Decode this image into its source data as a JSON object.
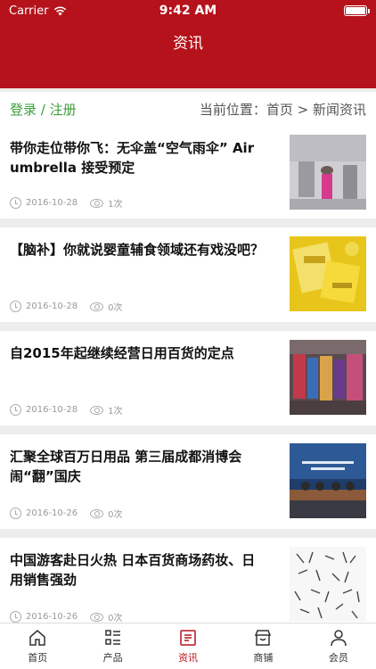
{
  "status": {
    "carrier": "Carrier",
    "time": "9:42 AM"
  },
  "nav": {
    "title": "资讯"
  },
  "crumb": {
    "login": "登录 / 注册",
    "position": "当前位置：首页 > 新闻资讯"
  },
  "articles": [
    {
      "title": "带你走位带你飞：无伞盖“空气雨伞” Air umbrella 接受预定",
      "date": "2016-10-28",
      "views": "1次"
    },
    {
      "title": "【脑补】你就说婴童辅食领域还有戏没吧？",
      "date": "2016-10-28",
      "views": "0次"
    },
    {
      "title": "自2015年起继续经营日用百货的定点",
      "date": "2016-10-28",
      "views": "1次"
    },
    {
      "title": "汇聚全球百万日用品 第三届成都消博会闹“翻”国庆",
      "date": "2016-10-26",
      "views": "0次"
    },
    {
      "title": "中国游客赴日火热 日本百货商场药妆、日用销售强劲",
      "date": "2016-10-26",
      "views": "0次"
    }
  ],
  "tabs": [
    {
      "label": "首页",
      "icon": "home-icon"
    },
    {
      "label": "产品",
      "icon": "list-icon"
    },
    {
      "label": "资讯",
      "icon": "news-icon"
    },
    {
      "label": "商铺",
      "icon": "shop-icon"
    },
    {
      "label": "会员",
      "icon": "user-icon"
    }
  ],
  "colors": {
    "brand": "#b5121b",
    "login": "#3c9d3c",
    "active_tab": "#b5121b"
  }
}
